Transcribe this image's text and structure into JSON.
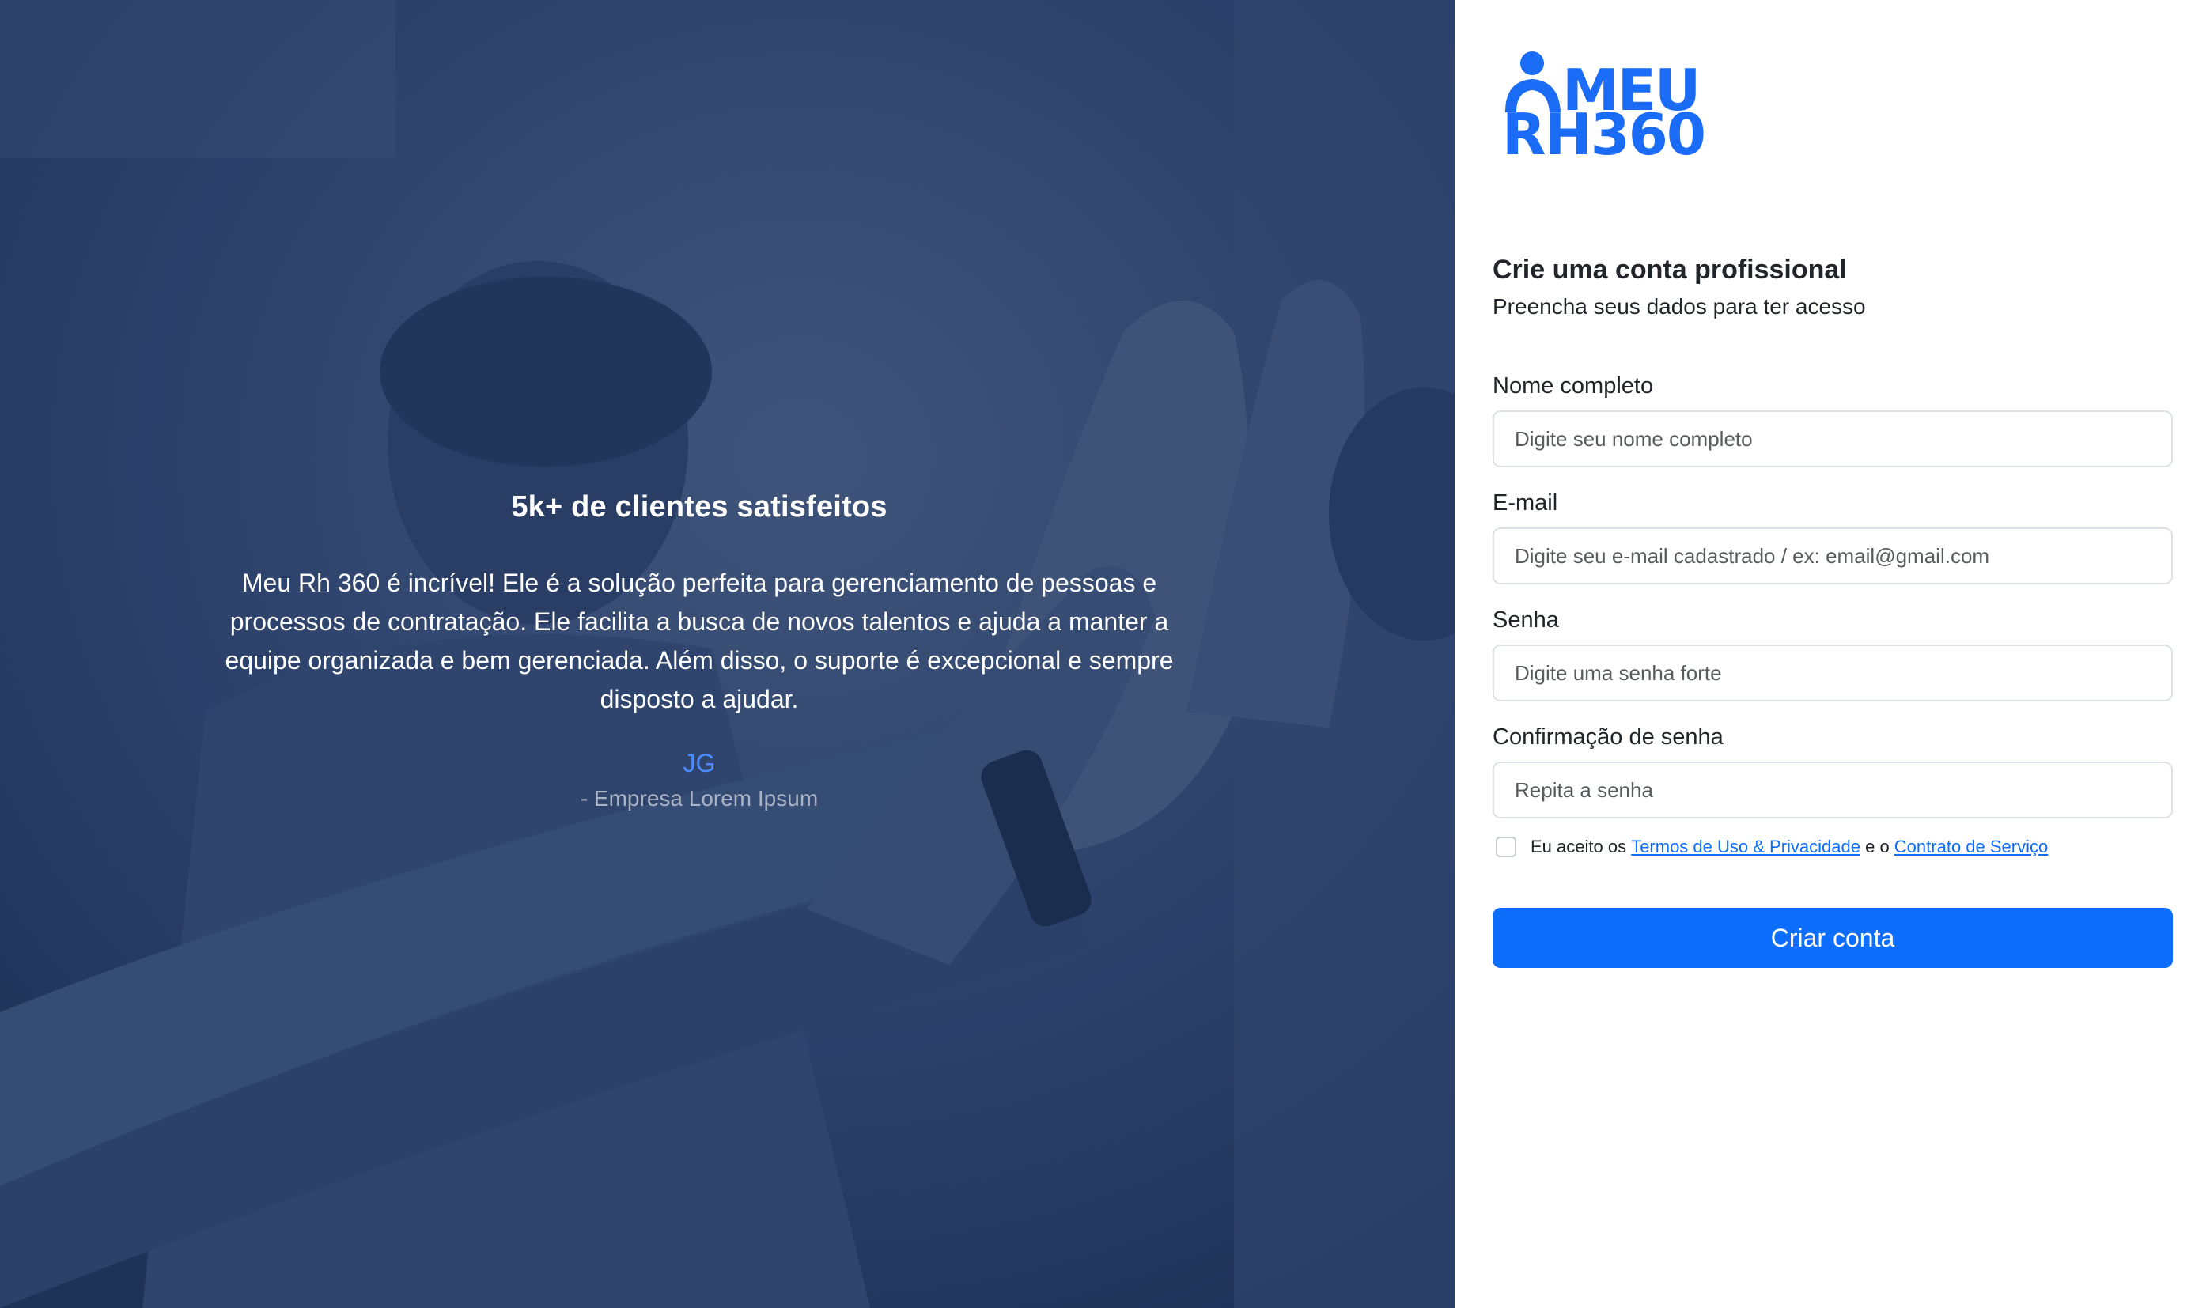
{
  "hero": {
    "title": "5k+ de clientes satisfeitos",
    "quote": "Meu Rh 360 é incrível! Ele é a solução perfeita para gerenciamento de pessoas e processos de contratação. Ele facilita a busca de novos talentos e ajuda a manter a equipe organizada e bem gerenciada. Além disso, o suporte é excepcional e sempre disposto a ajudar.",
    "author": "JG",
    "company": "- Empresa Lorem Ipsum",
    "overlay_color": "#1b3058"
  },
  "brand": {
    "logo_line1": "MEU",
    "logo_line2": "RH360",
    "color": "#1a6cf6"
  },
  "form": {
    "heading": "Crie uma conta profissional",
    "subheading": "Preencha seus dados para ter acesso",
    "fields": [
      {
        "label": "Nome completo",
        "placeholder": "Digite seu nome completo",
        "value": ""
      },
      {
        "label": "E-mail",
        "placeholder": "Digite seu e-mail cadastrado / ex: email@gmail.com",
        "value": ""
      },
      {
        "label": "Senha",
        "placeholder": "Digite uma senha forte",
        "value": ""
      },
      {
        "label": "Confirmação de senha",
        "placeholder": "Repita a senha",
        "value": ""
      }
    ],
    "terms": {
      "prefix": "Eu aceito os ",
      "terms_link": "Termos de Uso & Privacidade ",
      "middle": " e o ",
      "contract_link": "Contrato de Serviço",
      "checked": false
    },
    "submit_label": "Criar conta",
    "accent_color": "#0d6efd"
  }
}
